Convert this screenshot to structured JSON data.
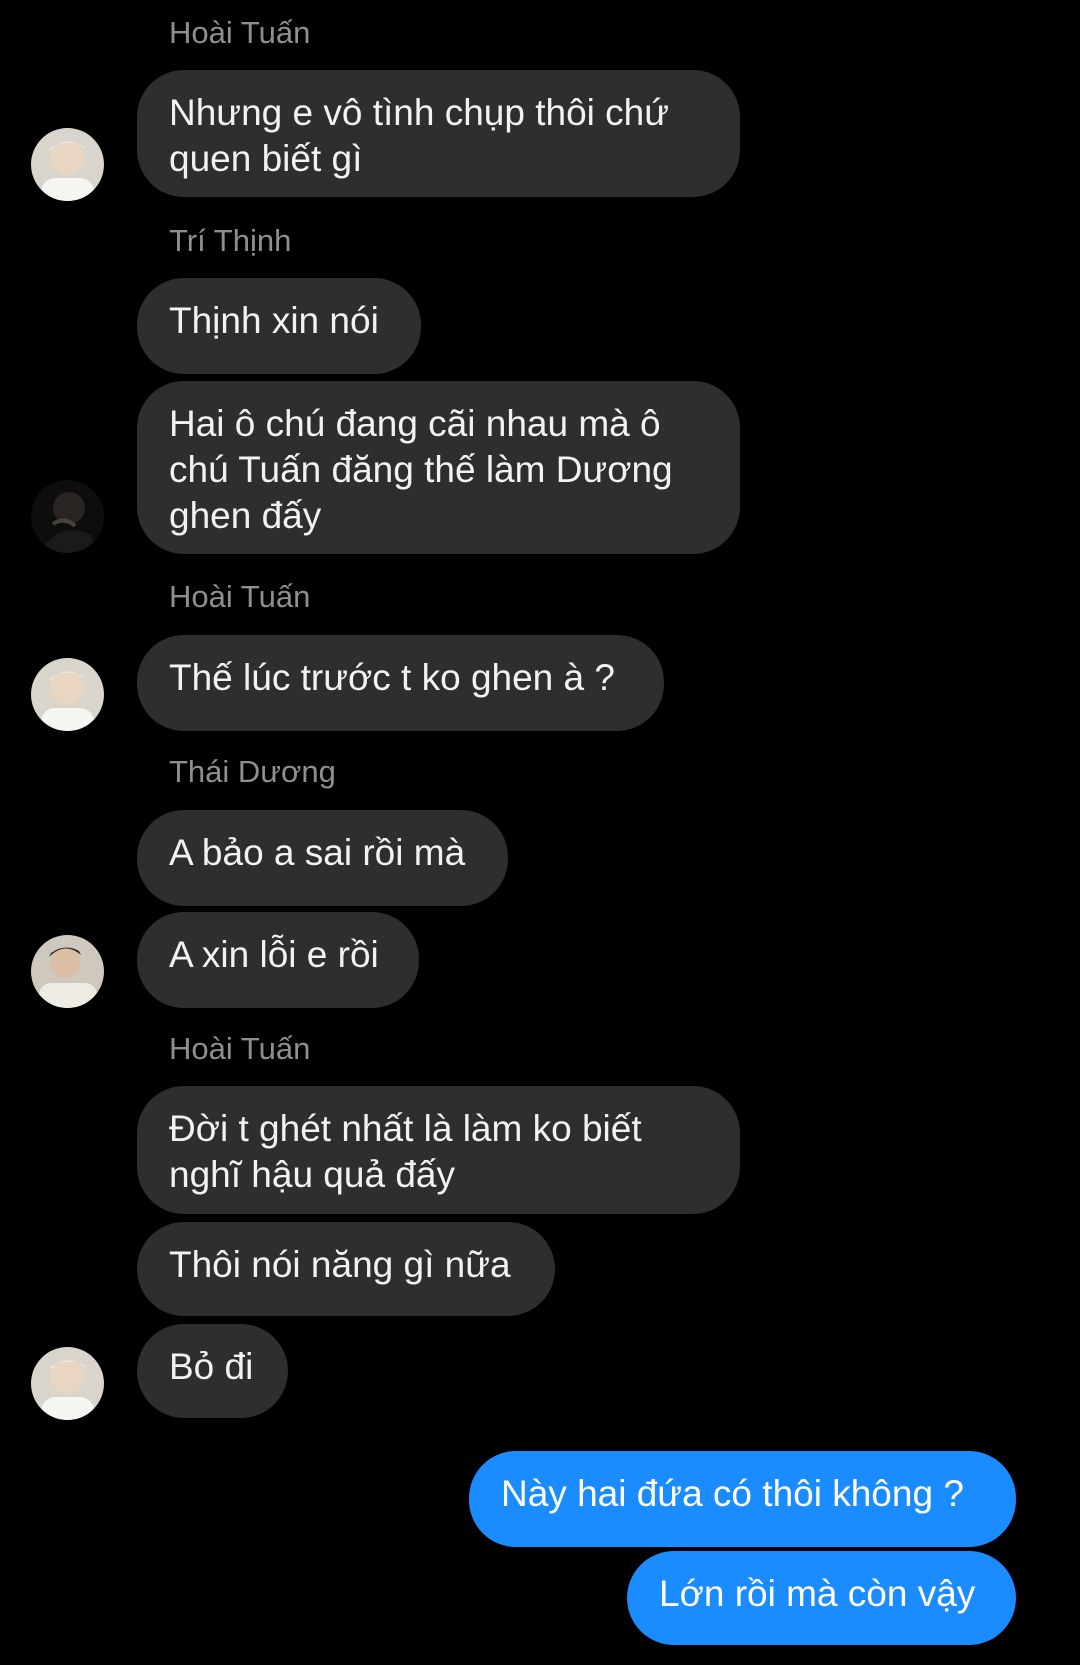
{
  "chat": {
    "senders": {
      "s1": "Hoài Tuấn",
      "s2": "Trí Thịnh",
      "s3": "Hoài Tuấn",
      "s4": "Thái Dương",
      "s5": "Hoài Tuấn"
    },
    "messages": {
      "m1_line1": "Nhưng e vô tình chụp thôi chứ",
      "m1_line2": "quen biết gì",
      "m2": "Thịnh xin nói",
      "m3_line1": "Hai ô chú đang cãi nhau mà ô",
      "m3_line2": "chú Tuấn đăng thế làm Dương",
      "m3_line3": "ghen đấy",
      "m4": "Thế lúc trước t ko ghen à ?",
      "m5": "A bảo a sai rồi mà",
      "m6": "A xin lỗi e rồi",
      "m7_line1": "Đời t ghét nhất là làm ko biết",
      "m7_line2": "nghĩ hậu quả đấy",
      "m8": "Thôi nói năng gì nữa",
      "m9": "Bỏ đi",
      "o1": "Này hai đứa có thôi không ?",
      "o2": "Lớn rồi mà còn vậy"
    },
    "colors": {
      "background": "#000000",
      "incoming_bubble": "#2e2e2e",
      "outgoing_bubble": "#1a8cff",
      "sender_name": "#8e8e93"
    },
    "avatars": {
      "hoai_tuan": "avatar-photo",
      "tri_thinh": "avatar-photo",
      "thai_duong": "avatar-photo"
    }
  }
}
